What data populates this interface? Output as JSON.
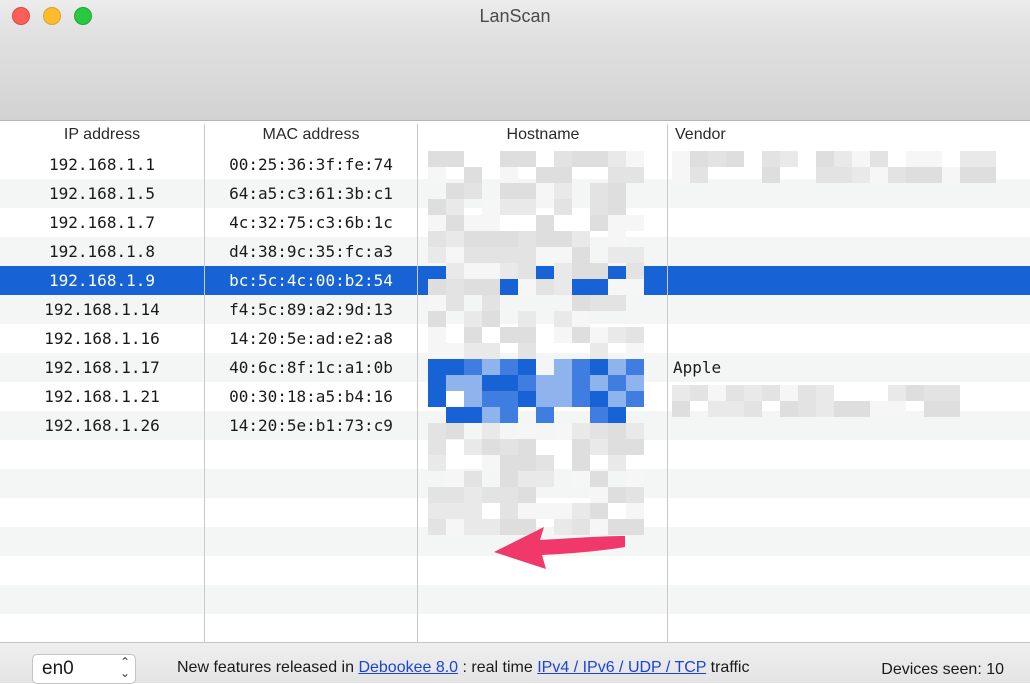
{
  "window": {
    "title": "LanScan"
  },
  "table": {
    "headers": {
      "ip": "IP address",
      "mac": "MAC address",
      "hostname": "Hostname",
      "vendor": "Vendor"
    },
    "rows": [
      {
        "ip": "192.168.1.1",
        "mac": "00:25:36:3f:fe:74",
        "vendor": ""
      },
      {
        "ip": "192.168.1.5",
        "mac": "64:a5:c3:61:3b:c1",
        "vendor": ""
      },
      {
        "ip": "192.168.1.7",
        "mac": "4c:32:75:c3:6b:1c",
        "vendor": ""
      },
      {
        "ip": "192.168.1.8",
        "mac": "d4:38:9c:35:fc:a3",
        "vendor": ""
      },
      {
        "ip": "192.168.1.9",
        "mac": "bc:5c:4c:00:b2:54",
        "vendor": "",
        "selected": true
      },
      {
        "ip": "192.168.1.14",
        "mac": "f4:5c:89:a2:9d:13",
        "vendor": ""
      },
      {
        "ip": "192.168.1.16",
        "mac": "14:20:5e:ad:e2:a8",
        "vendor": ""
      },
      {
        "ip": "192.168.1.17",
        "mac": "40:6c:8f:1c:a1:0b",
        "vendor": "Apple"
      },
      {
        "ip": "192.168.1.21",
        "mac": "00:30:18:a5:b4:16",
        "vendor": ""
      },
      {
        "ip": "192.168.1.26",
        "mac": "14:20:5e:b1:73:c9",
        "vendor": ""
      }
    ],
    "selection_color": "#1763d6",
    "redaction": "pixelated"
  },
  "annotation": {
    "icon": "arrow-left-icon",
    "color": "#f0386b"
  },
  "bottom_bar": {
    "interface_value": "en0",
    "promo_prefix": "New features released in",
    "promo_link_1": "Debookee 8.0",
    "promo_middle": ": real time",
    "promo_link_2": "IPv4 / IPv6 / UDP / TCP",
    "promo_suffix": "traffic",
    "devices_label": "Devices seen: 10"
  }
}
